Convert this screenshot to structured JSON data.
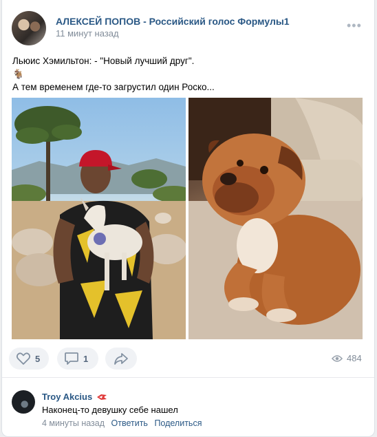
{
  "post": {
    "author": "АЛЕКСЕЙ ПОПОВ - Российский голос Формулы1",
    "time": "11 минут назад",
    "more_label": "•••",
    "text_line1": "Льюис Хэмильтон: - \"Новый лучший друг\".",
    "text_emoji": "🐐",
    "text_line2": "А тем временем где-то загрустил один Роско...",
    "photos": [
      {
        "subject": "man-holding-goat"
      },
      {
        "subject": "bulldog"
      }
    ]
  },
  "actions": {
    "likes": "5",
    "comments": "1",
    "views": "484"
  },
  "comment": {
    "author": "Troy Akcius",
    "text": "Наконец-то девушку себе нашел",
    "time": "4 минуты назад",
    "reply_label": "Ответить",
    "share_label": "Поделиться"
  },
  "colors": {
    "link": "#2a5885",
    "muted": "#818c99",
    "pill_bg": "#f0f2f5",
    "page_bg": "#edeef0"
  }
}
